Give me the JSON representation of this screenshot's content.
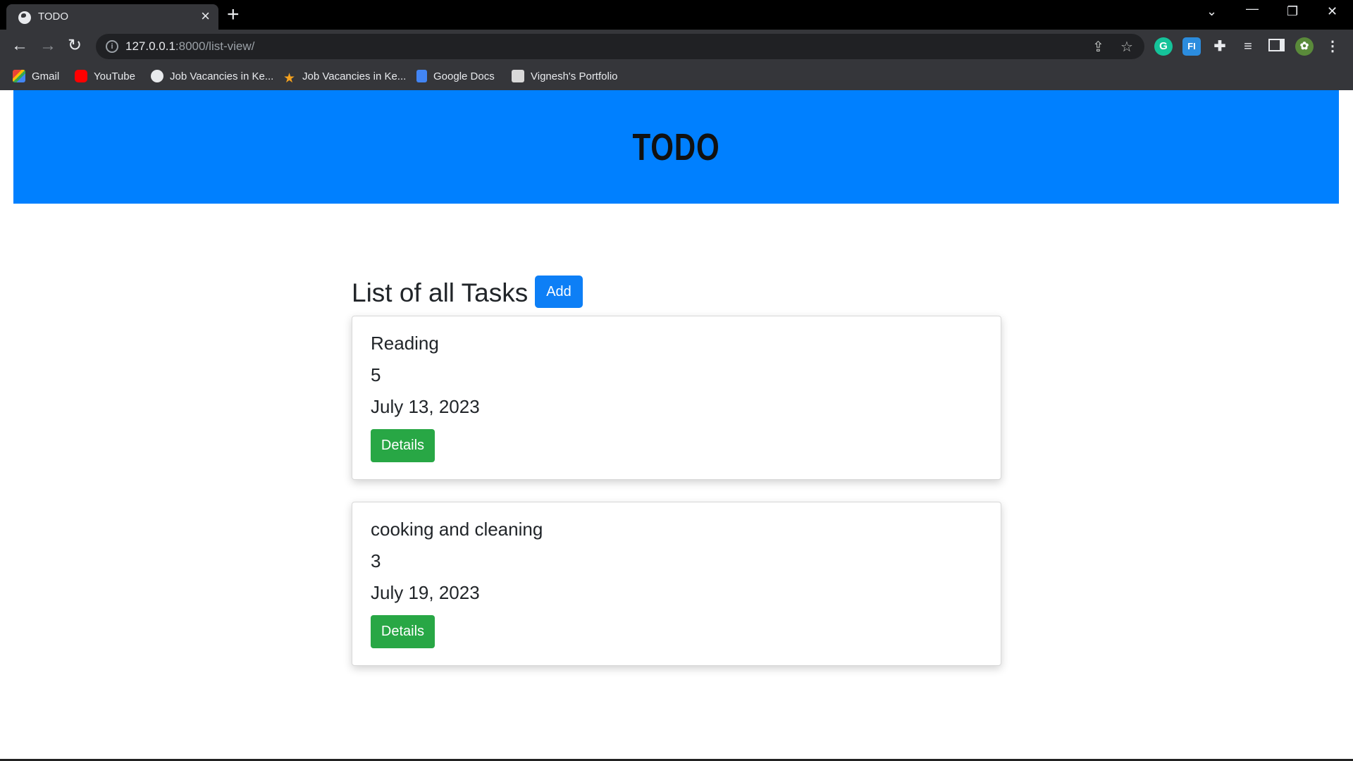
{
  "browser": {
    "tab_title": "TODO",
    "tab_close": "×",
    "new_tab": "+",
    "url_host": "127.0.0.1",
    "url_path": ":8000/list-view/",
    "bookmarks": [
      {
        "label": "Gmail",
        "icon": "gmail-icon"
      },
      {
        "label": "YouTube",
        "icon": "youtube-icon"
      },
      {
        "label": "Job Vacancies in Ke...",
        "icon": "globe-icon"
      },
      {
        "label": "Job Vacancies in Ke...",
        "icon": "star-icon"
      },
      {
        "label": "Google Docs",
        "icon": "docs-icon"
      },
      {
        "label": "Vignesh's Portfolio",
        "icon": "portfolio-icon"
      }
    ],
    "extensions": [
      {
        "name": "grammarly-icon",
        "glyph": "G",
        "color": "#15c39a"
      },
      {
        "name": "fi-extension-icon",
        "glyph": "FI",
        "color": "#2b8cde"
      }
    ]
  },
  "page": {
    "banner_title": "TODO",
    "banner_color": "#0080ff",
    "list_title": "List of all Tasks",
    "add_label": "Add",
    "tasks": [
      {
        "name": "Reading",
        "priority": "5",
        "date": "July 13, 2023",
        "button": "Details"
      },
      {
        "name": "cooking and cleaning",
        "priority": "3",
        "date": "July 19, 2023",
        "button": "Details"
      }
    ]
  }
}
